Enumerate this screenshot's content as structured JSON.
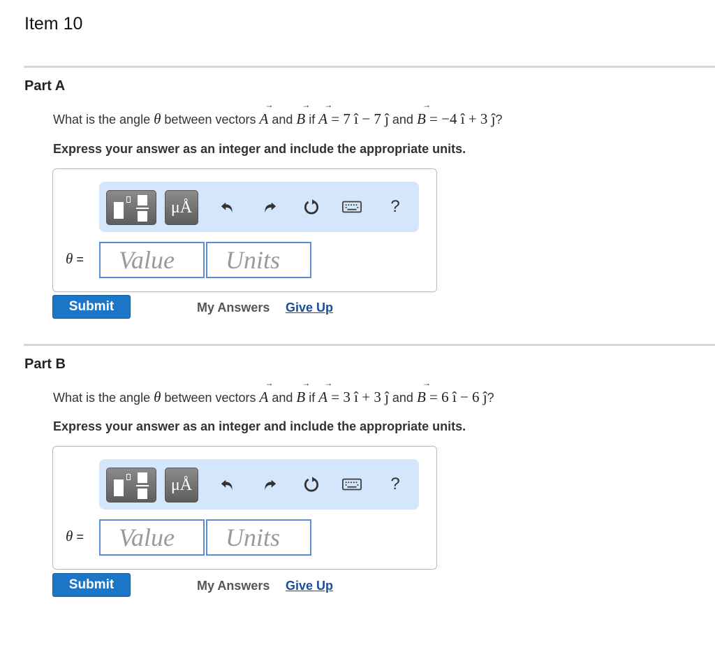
{
  "item_title": "Item 10",
  "colors": {
    "accent": "#1b76c8",
    "link": "#1a4d9c",
    "toolbar_bg": "#d3e6fb",
    "field_border": "#5b8ad8"
  },
  "parts": [
    {
      "title": "Part A",
      "question": {
        "prefix": "What is the angle ",
        "theta": "θ",
        "mid1": " between vectors ",
        "vecA": "A",
        "and1": " and ",
        "vecB": "B",
        "if": " if ",
        "eqA": " = 7 î − 7 ĵ",
        "and2": " and ",
        "eqB": " = −4 î + 3 ĵ",
        "end": "?"
      },
      "instruction": "Express your answer as an integer and include the appropriate units.",
      "toolbar": {
        "templates_icon": "templates-icon",
        "units_label": "μÅ",
        "undo_icon": "undo-icon",
        "redo_icon": "redo-icon",
        "reset_icon": "reset-icon",
        "keyboard_icon": "keyboard-icon",
        "help_label": "?"
      },
      "answer_label": "θ",
      "answer_eq": " =",
      "value_placeholder": "Value",
      "units_placeholder": "Units",
      "submit_label": "Submit",
      "my_answers_label": "My Answers",
      "give_up_label": "Give Up"
    },
    {
      "title": "Part B",
      "question": {
        "prefix": "What is the angle ",
        "theta": "θ",
        "mid1": " between vectors ",
        "vecA": "A",
        "and1": " and ",
        "vecB": "B",
        "if": " if ",
        "eqA": " = 3 î + 3 ĵ",
        "and2": " and ",
        "eqB": " = 6 î − 6 ĵ",
        "end": "?"
      },
      "instruction": "Express your answer as an integer and include the appropriate units.",
      "toolbar": {
        "templates_icon": "templates-icon",
        "units_label": "μÅ",
        "undo_icon": "undo-icon",
        "redo_icon": "redo-icon",
        "reset_icon": "reset-icon",
        "keyboard_icon": "keyboard-icon",
        "help_label": "?"
      },
      "answer_label": "θ",
      "answer_eq": " =",
      "value_placeholder": "Value",
      "units_placeholder": "Units",
      "submit_label": "Submit",
      "my_answers_label": "My Answers",
      "give_up_label": "Give Up"
    }
  ]
}
